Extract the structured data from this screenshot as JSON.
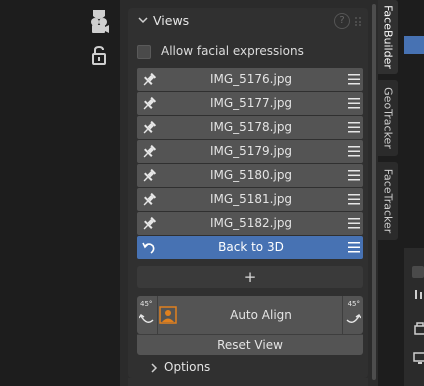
{
  "panel": {
    "title": "Views",
    "help_glyph": "?",
    "checkbox_label": "Allow facial expressions",
    "views": [
      "IMG_5176.jpg",
      "IMG_5177.jpg",
      "IMG_5178.jpg",
      "IMG_5179.jpg",
      "IMG_5180.jpg",
      "IMG_5181.jpg",
      "IMG_5182.jpg"
    ],
    "back_label": "Back to 3D",
    "add_glyph": "+",
    "rot_left_label": "45°",
    "rot_right_label": "45°",
    "auto_align_label": "Auto Align",
    "reset_label": "Reset View",
    "options_label": "Options"
  },
  "tabs": [
    "FaceBuilder",
    "GeoTracker",
    "FaceTracker"
  ],
  "colors": {
    "active_row": "#4772b3",
    "accent_orange": "#e0801e",
    "panel_bg": "#303030",
    "row_bg": "#545454"
  }
}
